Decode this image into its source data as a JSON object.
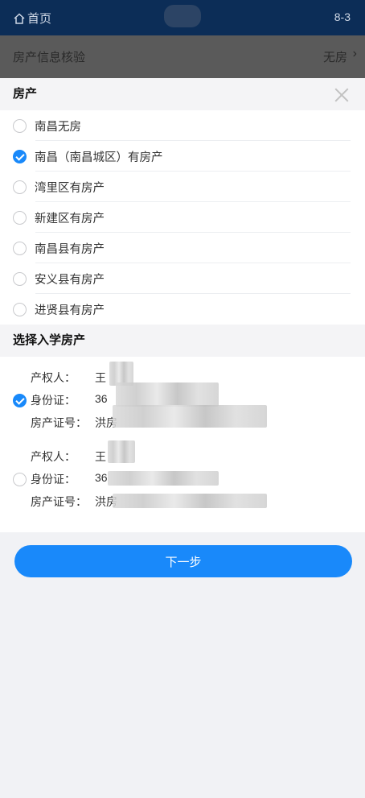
{
  "topbar": {
    "home_label": "首页",
    "page_label": "8-3"
  },
  "infobar": {
    "label": "房产信息核验",
    "value": "无房",
    "chevron": "›"
  },
  "property_section": {
    "title": "房产",
    "options": [
      {
        "label": "南昌无房",
        "checked": false
      },
      {
        "label": "南昌（南昌城区）有房产",
        "checked": true
      },
      {
        "label": "湾里区有房产",
        "checked": false
      },
      {
        "label": "新建区有房产",
        "checked": false
      },
      {
        "label": "南昌县有房产",
        "checked": false
      },
      {
        "label": "安义县有房产",
        "checked": false
      },
      {
        "label": "进贤县有房产",
        "checked": false
      }
    ]
  },
  "enroll_section": {
    "title": "选择入学房产",
    "properties": [
      {
        "checked": true,
        "owner_key": "产权人：",
        "owner_val": "王",
        "id_key": "身份证：",
        "id_val": "36",
        "cert_key": "房产证号：",
        "cert_val": "洪房"
      },
      {
        "checked": false,
        "owner_key": "产权人：",
        "owner_val": "王",
        "id_key": "身份证：",
        "id_val": "36",
        "cert_key": "房产证号：",
        "cert_val": "洪房"
      }
    ]
  },
  "next_button": {
    "label": "下一步"
  },
  "colors": {
    "accent": "#1989fa",
    "topbar": "#0c2d57"
  }
}
